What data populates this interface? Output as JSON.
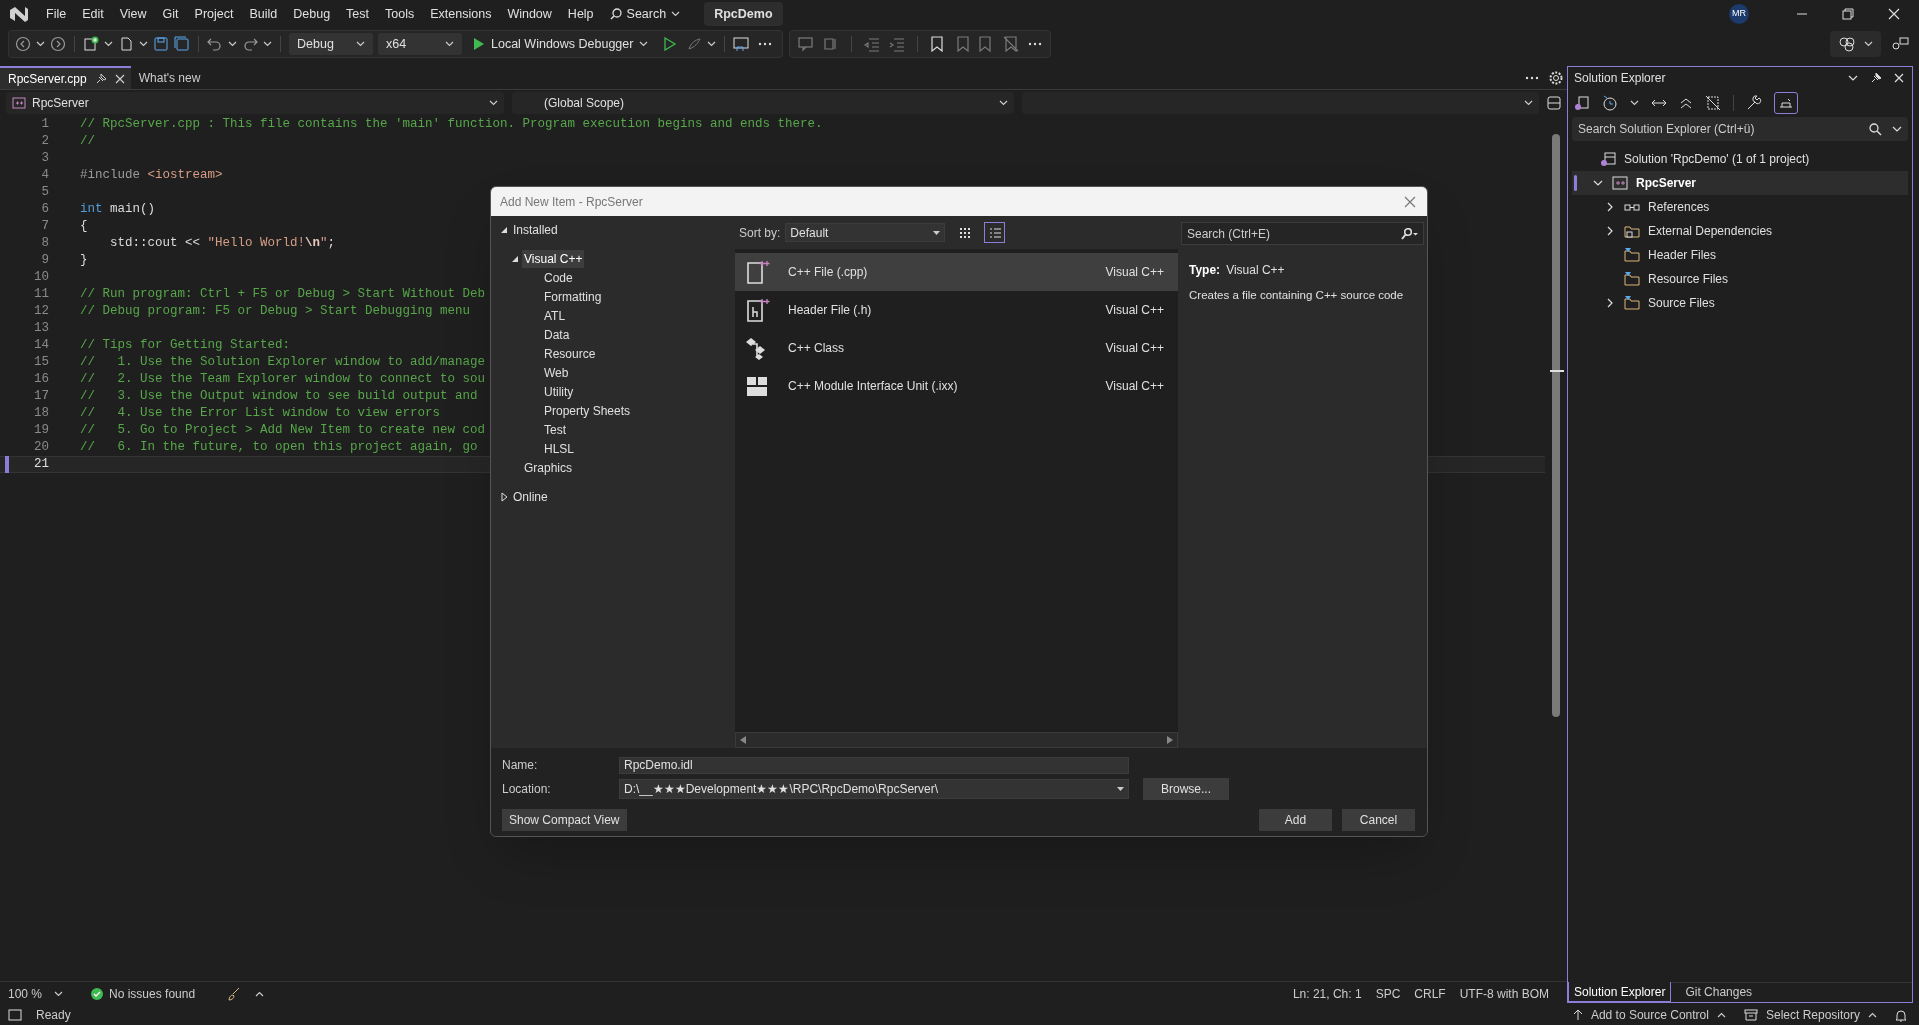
{
  "title_bar": {
    "menu": [
      "File",
      "Edit",
      "View",
      "Git",
      "Project",
      "Build",
      "Debug",
      "Test",
      "Tools",
      "Extensions",
      "Window",
      "Help"
    ],
    "search_label": "Search",
    "solution_name": "RpcDemo",
    "user_initials": "MR"
  },
  "toolbar": {
    "configuration": "Debug",
    "platform": "x64",
    "debugger": "Local Windows Debugger"
  },
  "tabs": [
    {
      "label": "RpcServer.cpp",
      "selected": true
    },
    {
      "label": "What's new",
      "selected": false
    }
  ],
  "nav_bar": {
    "project": "RpcServer",
    "scope": "(Global Scope)"
  },
  "editor": {
    "lines": [
      {
        "number": "1",
        "current": false,
        "tokens": [
          {
            "kind": "comment",
            "text": "// RpcServer.cpp : This file contains the 'main' function. Program execution begins and ends there."
          }
        ]
      },
      {
        "number": "2",
        "current": false,
        "tokens": [
          {
            "kind": "comment",
            "text": "//"
          }
        ]
      },
      {
        "number": "3",
        "current": false
      },
      {
        "number": "4",
        "current": false,
        "tokens": [
          {
            "kind": "preprocessor",
            "text": "#include "
          },
          {
            "kind": "include",
            "text": "<iostream>"
          }
        ]
      },
      {
        "number": "5",
        "current": false
      },
      {
        "number": "6",
        "current": false,
        "tokens": [
          {
            "kind": "keyword",
            "text": "int"
          },
          {
            "kind": "plain",
            "text": " main()"
          }
        ]
      },
      {
        "number": "7",
        "current": false,
        "tokens": [
          {
            "kind": "plain",
            "text": "{"
          }
        ]
      },
      {
        "number": "8",
        "current": false,
        "tokens": [
          {
            "kind": "plain",
            "text": "    std::cout << "
          },
          {
            "kind": "string",
            "text": "\"Hello World!"
          },
          {
            "kind": "escape",
            "text": "\\n"
          },
          {
            "kind": "string",
            "text": "\""
          },
          {
            "kind": "plain",
            "text": ";"
          }
        ]
      },
      {
        "number": "9",
        "current": false,
        "tokens": [
          {
            "kind": "plain",
            "text": "}"
          }
        ]
      },
      {
        "number": "10",
        "current": false
      },
      {
        "number": "11",
        "current": false,
        "tokens": [
          {
            "kind": "comment",
            "text": "// Run program: Ctrl + F5 or Debug > Start Without Deb"
          }
        ]
      },
      {
        "number": "12",
        "current": false,
        "tokens": [
          {
            "kind": "comment",
            "text": "// Debug program: F5 or Debug > Start Debugging menu"
          }
        ]
      },
      {
        "number": "13",
        "current": false
      },
      {
        "number": "14",
        "current": false,
        "tokens": [
          {
            "kind": "comment",
            "text": "// Tips for Getting Started:"
          }
        ]
      },
      {
        "number": "15",
        "current": false,
        "tokens": [
          {
            "kind": "comment",
            "text": "//   1. Use the Solution Explorer window to add/manage"
          }
        ]
      },
      {
        "number": "16",
        "current": false,
        "tokens": [
          {
            "kind": "comment",
            "text": "//   2. Use the Team Explorer window to connect to sou"
          }
        ]
      },
      {
        "number": "17",
        "current": false,
        "tokens": [
          {
            "kind": "comment",
            "text": "//   3. Use the Output window to see build output and"
          }
        ]
      },
      {
        "number": "18",
        "current": false,
        "tokens": [
          {
            "kind": "comment",
            "text": "//   4. Use the Error List window to view errors"
          }
        ]
      },
      {
        "number": "19",
        "current": false,
        "tokens": [
          {
            "kind": "comment",
            "text": "//   5. Go to Project > Add New Item to create new cod"
          }
        ]
      },
      {
        "number": "20",
        "current": false,
        "tokens": [
          {
            "kind": "comment",
            "text": "//   6. In the future, to open this project again, go"
          }
        ]
      },
      {
        "number": "21",
        "current": true
      }
    ]
  },
  "editor_status": {
    "zoom": "100 %",
    "issues": "No issues found",
    "position": "Ln: 21, Ch: 1",
    "indentation": "SPC",
    "line_endings": "CRLF",
    "encoding": "UTF-8 with BOM"
  },
  "dialog": {
    "title": "Add New Item - RpcServer",
    "tree": [
      {
        "label": "Installed",
        "expanded": true,
        "selected": false,
        "children": [
          {
            "label": "Visual C++",
            "expanded": true,
            "selected": true,
            "children": [
              {
                "label": "Code",
                "selected": false
              },
              {
                "label": "Formatting",
                "selected": false
              },
              {
                "label": "ATL",
                "selected": false
              },
              {
                "label": "Data",
                "selected": false
              },
              {
                "label": "Resource",
                "selected": false
              },
              {
                "label": "Web",
                "selected": false
              },
              {
                "label": "Utility",
                "selected": false
              },
              {
                "label": "Property Sheets",
                "selected": false
              },
              {
                "label": "Test",
                "selected": false
              },
              {
                "label": "HLSL",
                "selected": false
              }
            ]
          },
          {
            "label": "Graphics",
            "selected": false
          }
        ]
      },
      {
        "label": "Online",
        "expanded": false,
        "selected": false
      }
    ],
    "sort_label": "Sort by:",
    "sort_value": "Default",
    "view_buttons": [
      {
        "kind": "grid",
        "selected": false
      },
      {
        "kind": "list",
        "selected": true
      }
    ],
    "search": {
      "placeholder": "Search (Ctrl+E)"
    },
    "templates": [
      {
        "kind": "source",
        "name": "C++ File (.cpp)",
        "language": "Visual C++",
        "selected": true
      },
      {
        "kind": "header",
        "name": "Header File (.h)",
        "language": "Visual C++",
        "selected": false
      },
      {
        "kind": "class",
        "name": "C++ Class",
        "language": "Visual C++",
        "selected": false
      },
      {
        "kind": "module",
        "name": "C++ Module Interface Unit (.ixx)",
        "language": "Visual C++",
        "selected": false
      }
    ],
    "details": {
      "type_label": "Type:",
      "type_value": "Visual C++",
      "description": "Creates a file containing C++ source code"
    },
    "name_label": "Name:",
    "name_value": "RpcDemo.idl",
    "location_label": "Location:",
    "location_value": "D:\\__★★★Development★★★\\RPC\\RpcDemo\\RpcServer\\",
    "browse_button": "Browse...",
    "compact_button": "Show Compact View",
    "add_button": "Add",
    "cancel_button": "Cancel"
  },
  "solution_explorer": {
    "title": "Solution Explorer",
    "search": {
      "placeholder": "Search Solution Explorer (Ctrl+ü)"
    },
    "tree": [
      {
        "kind": "solution",
        "label": "Solution 'RpcDemo' (1 of 1 project)",
        "selected": false,
        "children": [
          {
            "kind": "project",
            "label": "RpcServer",
            "expanded": true,
            "selected": true,
            "children": [
              {
                "kind": "references",
                "label": "References",
                "expanded": false,
                "selected": false
              },
              {
                "kind": "dependencies",
                "label": "External Dependencies",
                "expanded": false,
                "selected": false
              },
              {
                "kind": "filter",
                "label": "Header Files",
                "selected": false
              },
              {
                "kind": "filter",
                "label": "Resource Files",
                "selected": false
              },
              {
                "kind": "filter",
                "label": "Source Files",
                "expanded": false,
                "selected": false
              }
            ]
          }
        ]
      }
    ],
    "tabs": [
      {
        "label": "Solution Explorer",
        "selected": true
      },
      {
        "label": "Git Changes",
        "selected": false
      }
    ]
  },
  "status_bar": {
    "state": "Ready",
    "source_control": "Add to Source Control",
    "repository": "Select Repository"
  }
}
